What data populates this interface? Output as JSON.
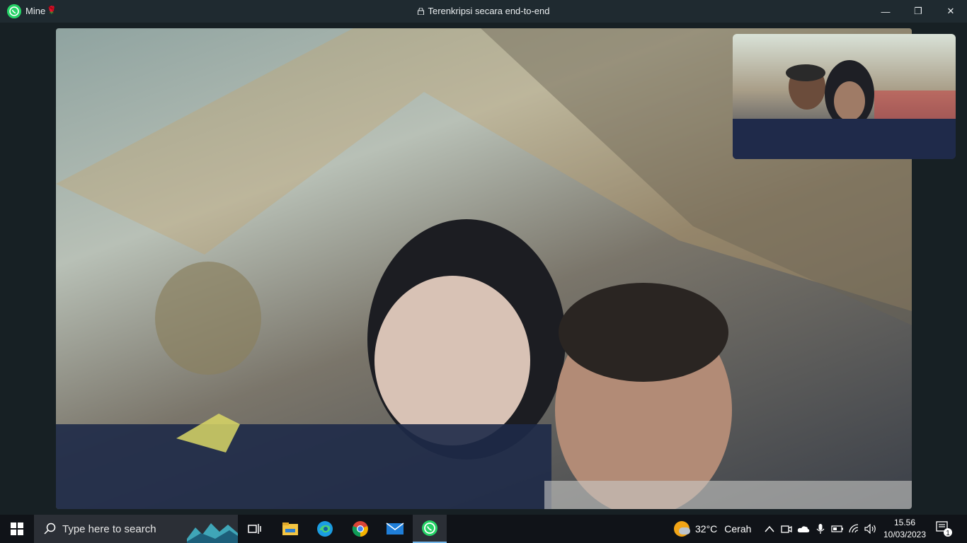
{
  "window": {
    "contact_name": "Mine",
    "contact_emoji": "🌹",
    "encryption_text": "Terenkripsi secara end-to-end",
    "controls": {
      "minimize": "—",
      "restore": "❐",
      "close": "✕"
    }
  },
  "call": {
    "main_video": "remote-video",
    "self_video": "self-preview"
  },
  "taskbar": {
    "search_placeholder": "Type here to search",
    "apps": [
      "task-view",
      "file-explorer",
      "edge",
      "chrome",
      "mail",
      "whatsapp"
    ],
    "weather_temp": "32°C",
    "weather_desc": "Cerah",
    "time": "15.56",
    "date": "10/03/2023",
    "notification_count": "1"
  },
  "colors": {
    "whatsapp_green": "#25d366",
    "titlebar": "#1f2a30",
    "taskbar": "#101318"
  }
}
